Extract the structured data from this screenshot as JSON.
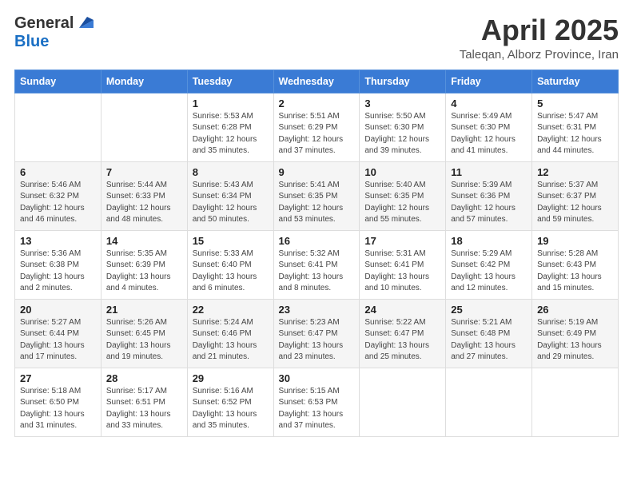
{
  "logo": {
    "general": "General",
    "blue": "Blue"
  },
  "header": {
    "month": "April 2025",
    "location": "Taleqan, Alborz Province, Iran"
  },
  "weekdays": [
    "Sunday",
    "Monday",
    "Tuesday",
    "Wednesday",
    "Thursday",
    "Friday",
    "Saturday"
  ],
  "weeks": [
    [
      {
        "day": "",
        "info": ""
      },
      {
        "day": "",
        "info": ""
      },
      {
        "day": "1",
        "info": "Sunrise: 5:53 AM\nSunset: 6:28 PM\nDaylight: 12 hours and 35 minutes."
      },
      {
        "day": "2",
        "info": "Sunrise: 5:51 AM\nSunset: 6:29 PM\nDaylight: 12 hours and 37 minutes."
      },
      {
        "day": "3",
        "info": "Sunrise: 5:50 AM\nSunset: 6:30 PM\nDaylight: 12 hours and 39 minutes."
      },
      {
        "day": "4",
        "info": "Sunrise: 5:49 AM\nSunset: 6:30 PM\nDaylight: 12 hours and 41 minutes."
      },
      {
        "day": "5",
        "info": "Sunrise: 5:47 AM\nSunset: 6:31 PM\nDaylight: 12 hours and 44 minutes."
      }
    ],
    [
      {
        "day": "6",
        "info": "Sunrise: 5:46 AM\nSunset: 6:32 PM\nDaylight: 12 hours and 46 minutes."
      },
      {
        "day": "7",
        "info": "Sunrise: 5:44 AM\nSunset: 6:33 PM\nDaylight: 12 hours and 48 minutes."
      },
      {
        "day": "8",
        "info": "Sunrise: 5:43 AM\nSunset: 6:34 PM\nDaylight: 12 hours and 50 minutes."
      },
      {
        "day": "9",
        "info": "Sunrise: 5:41 AM\nSunset: 6:35 PM\nDaylight: 12 hours and 53 minutes."
      },
      {
        "day": "10",
        "info": "Sunrise: 5:40 AM\nSunset: 6:35 PM\nDaylight: 12 hours and 55 minutes."
      },
      {
        "day": "11",
        "info": "Sunrise: 5:39 AM\nSunset: 6:36 PM\nDaylight: 12 hours and 57 minutes."
      },
      {
        "day": "12",
        "info": "Sunrise: 5:37 AM\nSunset: 6:37 PM\nDaylight: 12 hours and 59 minutes."
      }
    ],
    [
      {
        "day": "13",
        "info": "Sunrise: 5:36 AM\nSunset: 6:38 PM\nDaylight: 13 hours and 2 minutes."
      },
      {
        "day": "14",
        "info": "Sunrise: 5:35 AM\nSunset: 6:39 PM\nDaylight: 13 hours and 4 minutes."
      },
      {
        "day": "15",
        "info": "Sunrise: 5:33 AM\nSunset: 6:40 PM\nDaylight: 13 hours and 6 minutes."
      },
      {
        "day": "16",
        "info": "Sunrise: 5:32 AM\nSunset: 6:41 PM\nDaylight: 13 hours and 8 minutes."
      },
      {
        "day": "17",
        "info": "Sunrise: 5:31 AM\nSunset: 6:41 PM\nDaylight: 13 hours and 10 minutes."
      },
      {
        "day": "18",
        "info": "Sunrise: 5:29 AM\nSunset: 6:42 PM\nDaylight: 13 hours and 12 minutes."
      },
      {
        "day": "19",
        "info": "Sunrise: 5:28 AM\nSunset: 6:43 PM\nDaylight: 13 hours and 15 minutes."
      }
    ],
    [
      {
        "day": "20",
        "info": "Sunrise: 5:27 AM\nSunset: 6:44 PM\nDaylight: 13 hours and 17 minutes."
      },
      {
        "day": "21",
        "info": "Sunrise: 5:26 AM\nSunset: 6:45 PM\nDaylight: 13 hours and 19 minutes."
      },
      {
        "day": "22",
        "info": "Sunrise: 5:24 AM\nSunset: 6:46 PM\nDaylight: 13 hours and 21 minutes."
      },
      {
        "day": "23",
        "info": "Sunrise: 5:23 AM\nSunset: 6:47 PM\nDaylight: 13 hours and 23 minutes."
      },
      {
        "day": "24",
        "info": "Sunrise: 5:22 AM\nSunset: 6:47 PM\nDaylight: 13 hours and 25 minutes."
      },
      {
        "day": "25",
        "info": "Sunrise: 5:21 AM\nSunset: 6:48 PM\nDaylight: 13 hours and 27 minutes."
      },
      {
        "day": "26",
        "info": "Sunrise: 5:19 AM\nSunset: 6:49 PM\nDaylight: 13 hours and 29 minutes."
      }
    ],
    [
      {
        "day": "27",
        "info": "Sunrise: 5:18 AM\nSunset: 6:50 PM\nDaylight: 13 hours and 31 minutes."
      },
      {
        "day": "28",
        "info": "Sunrise: 5:17 AM\nSunset: 6:51 PM\nDaylight: 13 hours and 33 minutes."
      },
      {
        "day": "29",
        "info": "Sunrise: 5:16 AM\nSunset: 6:52 PM\nDaylight: 13 hours and 35 minutes."
      },
      {
        "day": "30",
        "info": "Sunrise: 5:15 AM\nSunset: 6:53 PM\nDaylight: 13 hours and 37 minutes."
      },
      {
        "day": "",
        "info": ""
      },
      {
        "day": "",
        "info": ""
      },
      {
        "day": "",
        "info": ""
      }
    ]
  ]
}
